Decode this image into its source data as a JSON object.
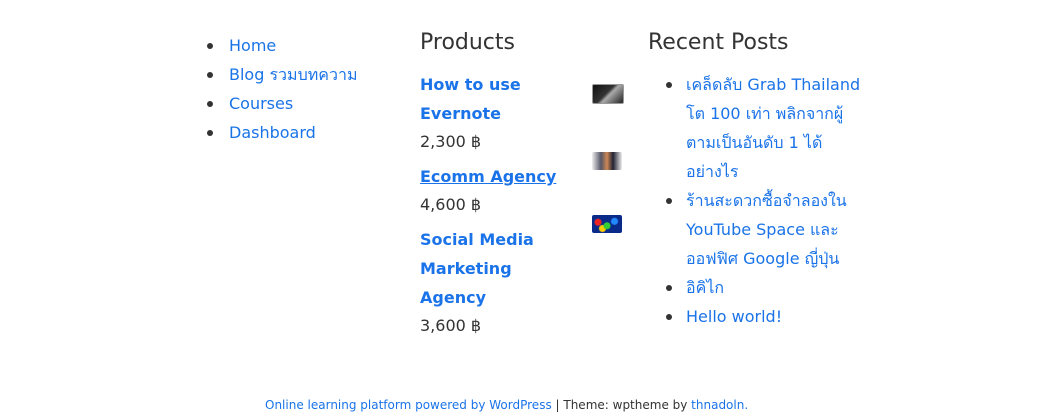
{
  "nav": {
    "items": [
      {
        "label": "Home"
      },
      {
        "label": "Blog รวมบทความ"
      },
      {
        "label": "Courses"
      },
      {
        "label": "Dashboard"
      }
    ]
  },
  "products": {
    "title": "Products",
    "items": [
      {
        "name": "How to use Evernote",
        "price": "2,300 ฿",
        "thumbnail_icon": "product-thumbnail-icon"
      },
      {
        "name": "Ecomm Agency",
        "price": "4,600 ฿",
        "thumbnail_icon": "product-thumbnail-icon"
      },
      {
        "name": "Social Media Marketing Agency",
        "price": "3,600 ฿",
        "thumbnail_icon": "product-thumbnail-icon"
      }
    ]
  },
  "recent_posts": {
    "title": "Recent Posts",
    "items": [
      {
        "label": "เคล็ดลับ Grab Thailand โต 100 เท่า พลิกจากผู้ตามเป็นอันดับ 1 ได้อย่างไร"
      },
      {
        "label": "ร้านสะดวกซื้อจำลองใน YouTube Space และออฟฟิศ Google ญี่ปุ่น"
      },
      {
        "label": "อิคิไก"
      },
      {
        "label": "Hello world!"
      }
    ]
  },
  "footer": {
    "platform_link": "Online learning platform powered by WordPress",
    "separator": " | Theme: wptheme by ",
    "author_link": "thnadoln."
  },
  "colors": {
    "link": "#1a73e8",
    "text": "#333333"
  }
}
